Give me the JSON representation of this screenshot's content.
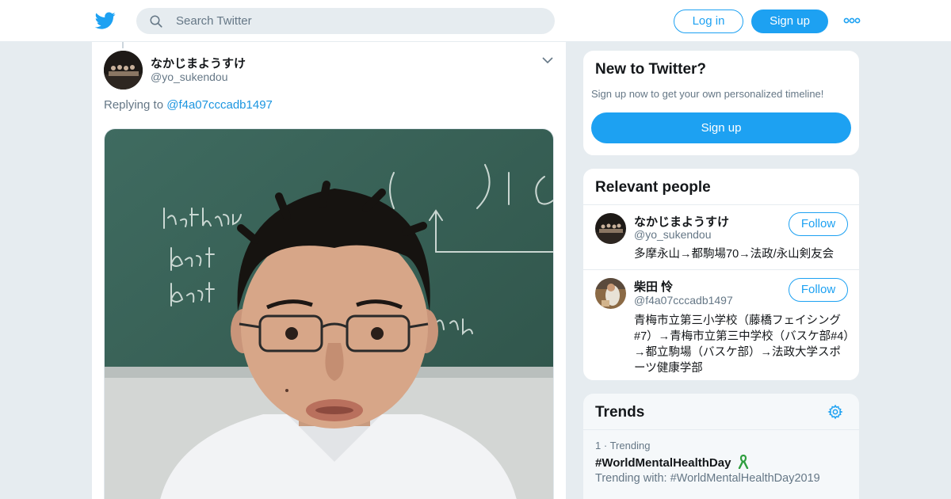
{
  "header": {
    "search_placeholder": "Search Twitter",
    "login_label": "Log in",
    "signup_label": "Sign up"
  },
  "tweet": {
    "author_name": "なかじまようすけ",
    "author_handle": "@yo_sukendou",
    "replying_prefix": "Replying to",
    "replying_handle": "@f4a07cccadb1497"
  },
  "new_to_twitter": {
    "title": "New to Twitter?",
    "subtitle": "Sign up now to get your own personalized timeline!",
    "signup_label": "Sign up"
  },
  "relevant_people": {
    "title": "Relevant people",
    "people": [
      {
        "name": "なかじまようすけ",
        "handle": "@yo_sukendou",
        "follow_label": "Follow",
        "bio": "多摩永山→都駒場70→法政/永山剣友会"
      },
      {
        "name": "柴田 怜",
        "handle": "@f4a07cccadb1497",
        "follow_label": "Follow",
        "bio": "青梅市立第三小学校（藤橋フェイシング#7）→青梅市立第三中学校（バスケ部#4）→都立駒場（バスケ部）→法政大学スポーツ健康学部"
      }
    ]
  },
  "trends": {
    "title": "Trends",
    "items": [
      {
        "rank": "1",
        "separator": "·",
        "category": "Trending",
        "tag": "#WorldMentalHealthDay",
        "with_prefix": "Trending with:",
        "with_tag": "#WorldMentalHealthDay2019"
      }
    ]
  },
  "colors": {
    "brand": "#1da1f2",
    "link": "#1b95e0",
    "text_secondary": "#657786",
    "background": "#e6ecf0"
  },
  "icons": [
    "twitter-bird-icon",
    "search-icon",
    "more-dots-icon",
    "chevron-down-icon",
    "gear-icon",
    "green-ribbon-icon"
  ]
}
